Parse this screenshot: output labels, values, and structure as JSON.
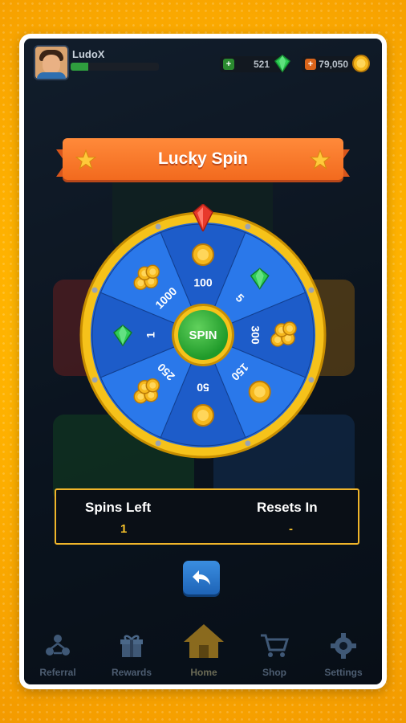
{
  "profile": {
    "username": "LudoX",
    "xp_progress": 0.2
  },
  "currency": {
    "gems": "521",
    "coins": "79,050",
    "gem_color": "#29c24a",
    "coin_color": "#f2a81d"
  },
  "modal": {
    "title": "Lucky Spin",
    "wheel": {
      "segments": [
        {
          "label": "100",
          "reward": "coin-icon"
        },
        {
          "label": "5",
          "reward": "gem-icon"
        },
        {
          "label": "300",
          "reward": "coin-stack-icon"
        },
        {
          "label": "150",
          "reward": "coin-icon"
        },
        {
          "label": "50",
          "reward": "coin-icon"
        },
        {
          "label": "250",
          "reward": "coin-stack-icon"
        },
        {
          "label": "1",
          "reward": "gem-icon"
        },
        {
          "label": "1000",
          "reward": "coin-stack-icon"
        }
      ],
      "spin_label": "SPIN"
    },
    "spins_left_label": "Spins Left",
    "spins_left_value": "1",
    "resets_in_label": "Resets In",
    "resets_in_value": "-"
  },
  "nav": {
    "items": [
      {
        "label": "Referral",
        "icon": "referral-icon"
      },
      {
        "label": "Rewards",
        "icon": "gift-icon"
      },
      {
        "label": "Home",
        "icon": "home-icon"
      },
      {
        "label": "Shop",
        "icon": "cart-icon"
      },
      {
        "label": "Settings",
        "icon": "gear-icon"
      }
    ]
  },
  "colors": {
    "wheel_blue": "#1f63d8",
    "gold": "#f6c21a",
    "accent_orange": "#f26a1e"
  }
}
